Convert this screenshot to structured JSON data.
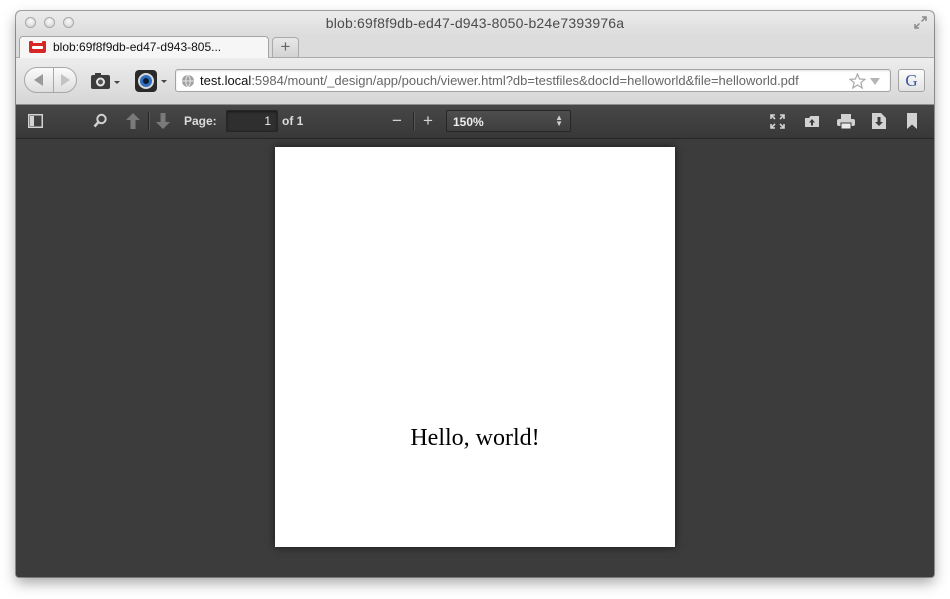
{
  "window": {
    "title": "blob:69f8f9db-ed47-d943-8050-b24e7393976a"
  },
  "tabs": [
    {
      "title": "blob:69f8f9db-ed47-d943-805...",
      "active": true
    }
  ],
  "newtab": {
    "label": "+"
  },
  "navbar": {
    "url_host": "test.local",
    "url_rest": ":5984/mount/_design/app/pouch/viewer.html?db=testfiles&docId=helloworld&file=helloworld.pdf",
    "extension_label": "G"
  },
  "pdf_toolbar": {
    "page_label": "Page:",
    "page_value": "1",
    "page_count": "of 1",
    "zoom_out": "−",
    "zoom_in": "+",
    "zoom_value": "150%"
  },
  "document": {
    "text": "Hello, world!"
  },
  "icons": {
    "traffic_lights": [
      "close-button",
      "minimize-button",
      "zoom-button"
    ],
    "toolbar": [
      "sidebar-toggle-icon",
      "search-icon",
      "previous-page-icon",
      "next-page-icon",
      "presentation-mode-icon",
      "open-file-icon",
      "print-icon",
      "download-icon",
      "bookmark-icon"
    ]
  }
}
